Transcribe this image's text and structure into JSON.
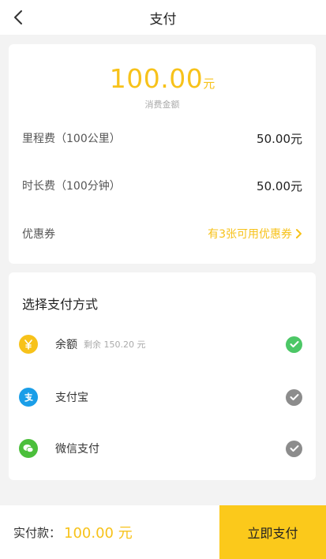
{
  "header": {
    "title": "支付"
  },
  "summary": {
    "amount": "100.00",
    "amount_unit": "元",
    "amount_label": "消费金额",
    "rows": [
      {
        "label": "里程费（100公里）",
        "value": "50.00元"
      },
      {
        "label": "时长费（100分钟）",
        "value": "50.00元"
      }
    ],
    "coupon": {
      "label": "优惠券",
      "value": "有3张可用优惠券"
    }
  },
  "payment": {
    "title": "选择支付方式",
    "methods": [
      {
        "label": "余额",
        "sub": "剩余 150.20 元",
        "icon": "yen-icon",
        "icon_color": "#f7c21a",
        "selected": true
      },
      {
        "label": "支付宝",
        "sub": "",
        "icon": "alipay-icon",
        "icon_color": "#1a9ee8",
        "selected": false
      },
      {
        "label": "微信支付",
        "sub": "",
        "icon": "wechat-icon",
        "icon_color": "#4bbf3b",
        "selected": false
      }
    ],
    "selected_color": "#4cc766",
    "unselected_color": "#8c8c8c"
  },
  "footer": {
    "label": "实付款：",
    "amount": "100.00 元",
    "pay_button": "立即支付"
  },
  "colors": {
    "accent": "#f7c21a",
    "button": "#fbc91b"
  }
}
